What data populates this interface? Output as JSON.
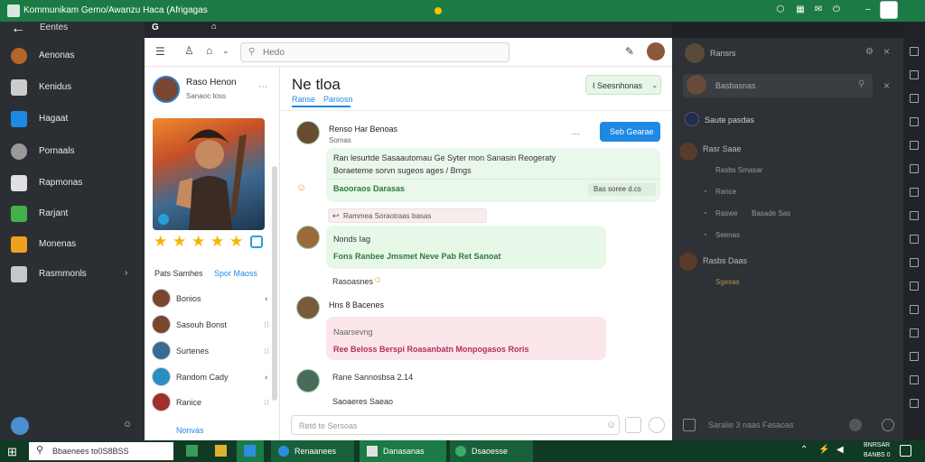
{
  "window": {
    "title": "Kommunikam Gemo/Awanzu Haca (Afrigagas"
  },
  "nav": {
    "items": [
      {
        "label": "Aenonas",
        "icon": "avatar-icon"
      },
      {
        "label": "Kenidus",
        "icon": "bookmark-icon"
      },
      {
        "label": "Hagaat",
        "icon": "chat-icon"
      },
      {
        "label": "Pornaals",
        "icon": "gear-icon"
      },
      {
        "label": "Rapmonas",
        "icon": "send-icon"
      },
      {
        "label": "Rarjant",
        "icon": "note-icon"
      },
      {
        "label": "Monenas",
        "icon": "folder-icon"
      },
      {
        "label": "Rasmmonls",
        "icon": "grid-icon"
      }
    ]
  },
  "search": {
    "placeholder": "Hedo"
  },
  "profile": {
    "name": "Raso Henon",
    "status": "Sanaoc toss",
    "section_left": "Pats Samhes",
    "section_right": "Spor Maoss",
    "friends": [
      {
        "name": "Bonios",
        "state": "◐"
      },
      {
        "name": "Sasouh Bonst",
        "state": "⁝⁝"
      },
      {
        "name": "Surtenes",
        "state": "⁝⁝"
      },
      {
        "name": "Random Cady",
        "state": "◐"
      },
      {
        "name": "Ranice",
        "state": "⁝⁝"
      }
    ],
    "more_link": "Nonvas"
  },
  "chat": {
    "title": "Ne tloa",
    "tabs": [
      "Ranse",
      "Paniosn"
    ],
    "status_chip": "I Seesnhonas",
    "follow_button": "Seb Gearae",
    "msgs": [
      {
        "author": "Renso Har Benoas",
        "sub": "Somas",
        "line1": "Ran lesurtde Sasaautomau Ge Syter mon  Sanasin  Reogeraty",
        "line2": "Boraeteme sorvn sugeos ages / Bmgs",
        "line3": "Baooraos Darasas",
        "line3_side": "Bas soree d.cs",
        "reaction": "Rammea Soraotraas basas"
      },
      {
        "greeting": "Nonds Iag",
        "line1": "Fons Ranbee Jmsmet   Neve Pab Ret  Sanoat",
        "reaction": "Rasoasnes"
      },
      {
        "author": "Hns 8 Bacenes",
        "greeting": "Naarsevng",
        "line1": "Ree Beloss Berspi  Roasanbatn Monpogasos Roris"
      },
      {
        "author": "Rane Sannosbsa 2.14",
        "line1": "Saoaeres   Saeao"
      }
    ],
    "composer_placeholder": "Retd te Sersoas"
  },
  "right": {
    "title": "Ransrs",
    "search_text": "Basbasnas",
    "section": "Saute pasdas",
    "items": [
      {
        "name": "Rasr Saae",
        "sub": "Rasbs Smasar"
      },
      {
        "name": "Rance",
        "sub": "Rassas"
      },
      {
        "name": "Raswe",
        "sub": "Basade Sas"
      },
      {
        "name": "Seenas",
        "sub": ""
      },
      {
        "name": "Rasbs Daas",
        "sub": "Sgesas"
      }
    ],
    "composer": "Saralie 3 naas Fasaoas"
  },
  "taskbar": {
    "search": "Bbaenees to0S8BSS",
    "apps": [
      "Renaanees",
      "Danasanas",
      "Dsaoesse"
    ],
    "time": "BNRSAR",
    "date": "BANBS 0"
  },
  "colors": {
    "brand": "#1c7a45",
    "accent": "#1e88e5",
    "sidebar": "#2b2f34"
  }
}
